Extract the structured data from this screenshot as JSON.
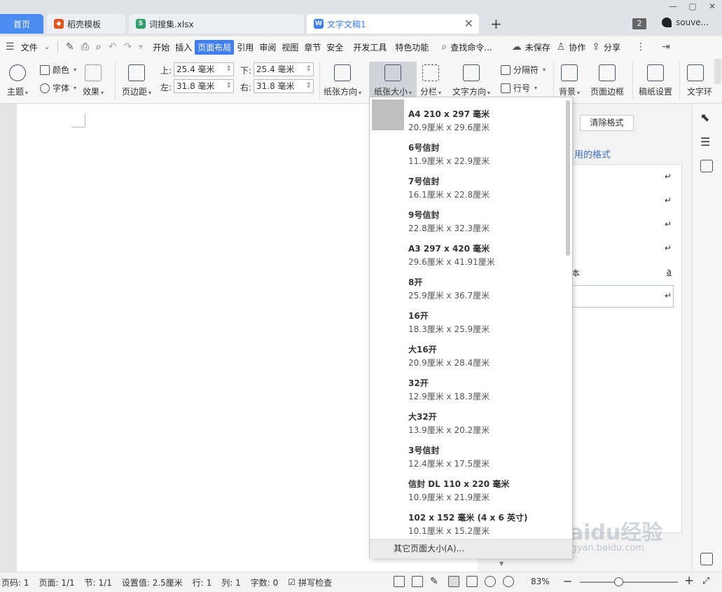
{
  "tabs": {
    "home": "首页",
    "docer": "稻壳模板",
    "xlsx": "词搜集.xlsx",
    "doc": "文字文稿1",
    "badge": "2",
    "user": "souve..."
  },
  "menu": {
    "file": "文件",
    "items": [
      "开始",
      "插入",
      "页面布局",
      "引用",
      "审阅",
      "视图",
      "章节",
      "安全",
      "开发工具",
      "特色功能"
    ],
    "search": "查找命令...",
    "unsaved": "未保存",
    "collab": "协作",
    "share": "分享"
  },
  "ribbon": {
    "theme": "主题",
    "color": "颜色",
    "font": "字体",
    "effect": "效果",
    "margins": "页边距",
    "top_label": "上:",
    "top_value": "25.4 毫米",
    "bottom_label": "下:",
    "bottom_value": "25.4 毫米",
    "left_label": "左:",
    "left_value": "31.8 毫米",
    "right_label": "右:",
    "right_value": "31.8 毫米",
    "orientation": "纸张方向",
    "paper_size": "纸张大小",
    "columns": "分栏",
    "text_direction": "文字方向",
    "separator": "分隔符",
    "line_number": "行号",
    "background": "背景",
    "page_border": "页面边框",
    "manuscript": "稿纸设置",
    "text_wrap": "文字环"
  },
  "style_pane": {
    "clear_format": "清除格式",
    "heading": "用的格式",
    "frag": "本",
    "frag2": "a"
  },
  "dropdown": {
    "items": [
      {
        "name": "A4 210 x 297 毫米",
        "size": "20.9厘米  x  29.6厘米"
      },
      {
        "name": "6号信封",
        "size": "11.9厘米  x  22.9厘米"
      },
      {
        "name": "7号信封",
        "size": "16.1厘米  x  22.8厘米"
      },
      {
        "name": "9号信封",
        "size": "22.8厘米  x  32.3厘米"
      },
      {
        "name": "A3 297 x 420 毫米",
        "size": "29.6厘米  x  41.91厘米"
      },
      {
        "name": "8开",
        "size": "25.9厘米  x  36.7厘米"
      },
      {
        "name": "16开",
        "size": "18.3厘米  x  25.9厘米"
      },
      {
        "name": "大16开",
        "size": "20.9厘米  x  28.4厘米"
      },
      {
        "name": "32开",
        "size": "12.9厘米  x  18.3厘米"
      },
      {
        "name": "大32开",
        "size": "13.9厘米  x  20.2厘米"
      },
      {
        "name": "3号信封",
        "size": "12.4厘米  x  17.5厘米"
      },
      {
        "name": "信封 DL 110 x 220 毫米",
        "size": "10.9厘米  x  21.9厘米"
      },
      {
        "name": "102 x 152 毫米 (4 x 6 英寸)",
        "size": "10.1厘米  x  15.2厘米"
      }
    ],
    "footer": "其它页面大小(A)..."
  },
  "status": {
    "page_code": "页码: 1",
    "pages": "页面: 1/1",
    "section": "节: 1/1",
    "setting": "设置值: 2.5厘米",
    "row": "行: 1",
    "col": "列: 1",
    "words": "字数: 0",
    "spell": "拼写检查",
    "zoom": "83%"
  },
  "watermark": {
    "main": "Baidu经验",
    "sub": "jingyan.baidu.com"
  },
  "colors": {
    "accent": "#3e7ef0",
    "home_tab": "#4a8cf0"
  }
}
